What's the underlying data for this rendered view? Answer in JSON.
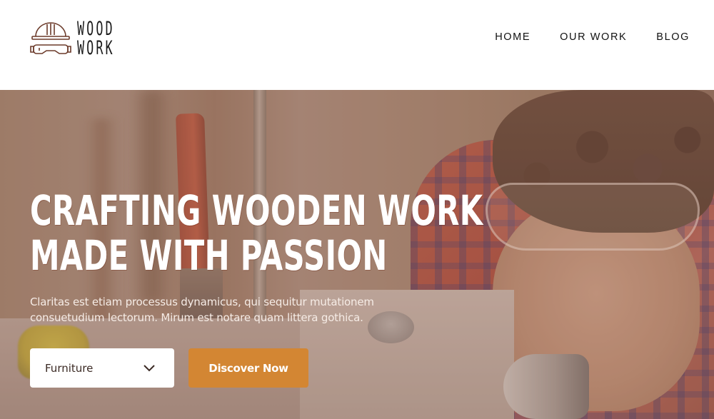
{
  "header": {
    "logo": {
      "icon": "hardhat-goggles-icon",
      "line1": "WOOD",
      "line2": "WORK",
      "color": "#6b3a2a"
    },
    "nav": [
      {
        "label": "HOME"
      },
      {
        "label": "OUR WORK"
      },
      {
        "label": "BLOG"
      }
    ]
  },
  "hero": {
    "title_line1": "CRAFTING WOODEN WORK",
    "title_line2": "MADE WITH PASSION",
    "description": "Claritas est etiam processus dynamicus, qui sequitur mutationem consuetudium lectorum. Mirum est notare quam littera gothica.",
    "category_select": {
      "selected": "Furniture",
      "icon": "chevron-down-icon"
    },
    "cta_label": "Discover Now",
    "accent_color": "#d38633"
  }
}
